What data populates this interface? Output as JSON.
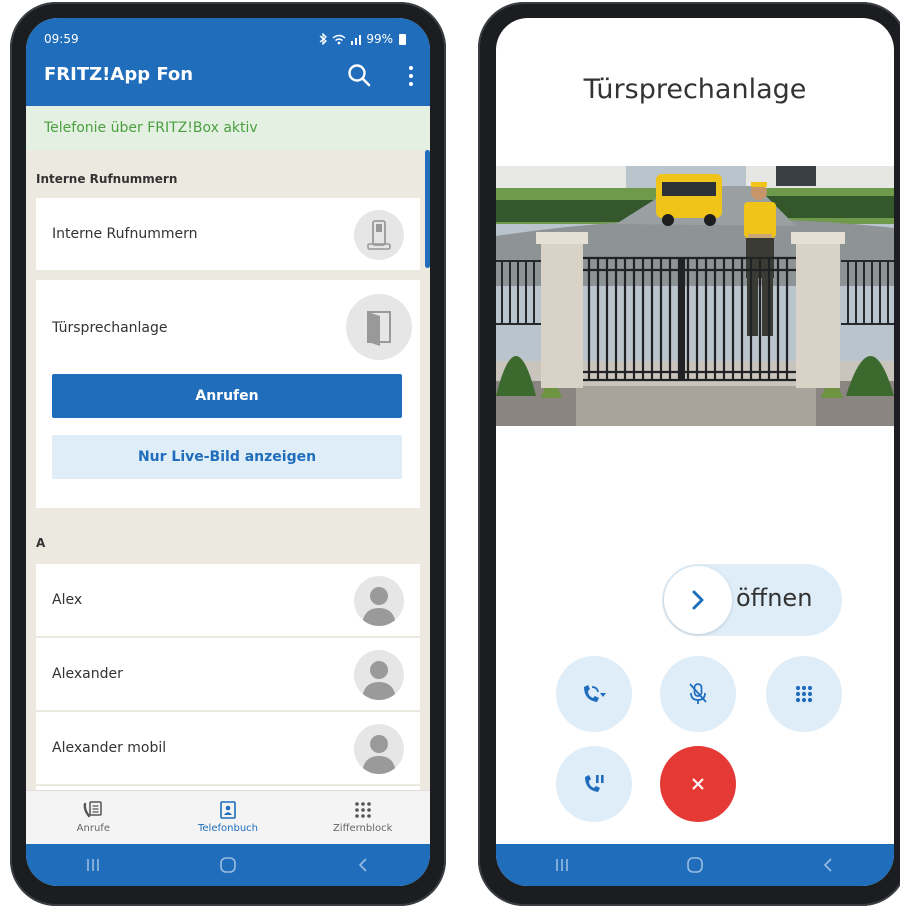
{
  "left_phone": {
    "status": {
      "time": "09:59",
      "battery": "99%"
    },
    "app_title": "FRITZ!App Fon",
    "banner": "Telefonie über FRITZ!Box aktiv",
    "section_internal": "Interne Rufnummern",
    "internal_item": "Interne Rufnummern",
    "door_item": "Türsprechanlage",
    "call_button": "Anrufen",
    "live_button": "Nur Live-Bild anzeigen",
    "section_a": "A",
    "contacts": [
      "Alex",
      "Alexander",
      "Alexander mobil"
    ],
    "nav": [
      {
        "label": "Anrufe",
        "icon": "call-list-icon"
      },
      {
        "label": "Telefonbuch",
        "icon": "phonebook-icon",
        "active": true
      },
      {
        "label": "Ziffernblock",
        "icon": "dialpad-icon"
      }
    ]
  },
  "right_phone": {
    "title": "Türsprechanlage",
    "open_label": "öffnen",
    "buttons": [
      "call-forward-icon",
      "mic-mute-icon",
      "dialpad-icon",
      "call-hold-icon",
      "hangup-icon"
    ]
  },
  "colors": {
    "brand_blue": "#1f6dbb",
    "light_blue": "#deedf8",
    "banner_green": "#4aa03f",
    "hangup_red": "#e53935"
  }
}
